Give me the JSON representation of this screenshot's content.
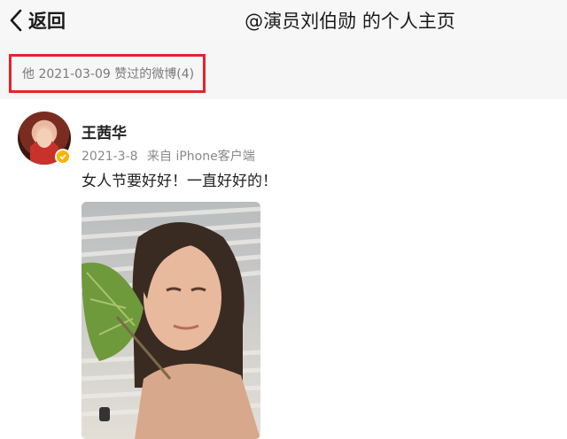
{
  "header": {
    "back_label": "返回",
    "title": "@演员刘伯勋 的个人主页"
  },
  "section": {
    "label": "他 2021-03-09 赞过的微博(4)",
    "highlight_color": "#e5232a"
  },
  "post": {
    "author": "王茜华",
    "date": "2021-3-8",
    "source": "来自 iPhone客户端",
    "text": "女人节要好好！一直好好的！",
    "verified_badge_color": "#f7b500"
  },
  "icons": {
    "back": "chevron-left-icon",
    "verified": "verified-badge-icon"
  }
}
